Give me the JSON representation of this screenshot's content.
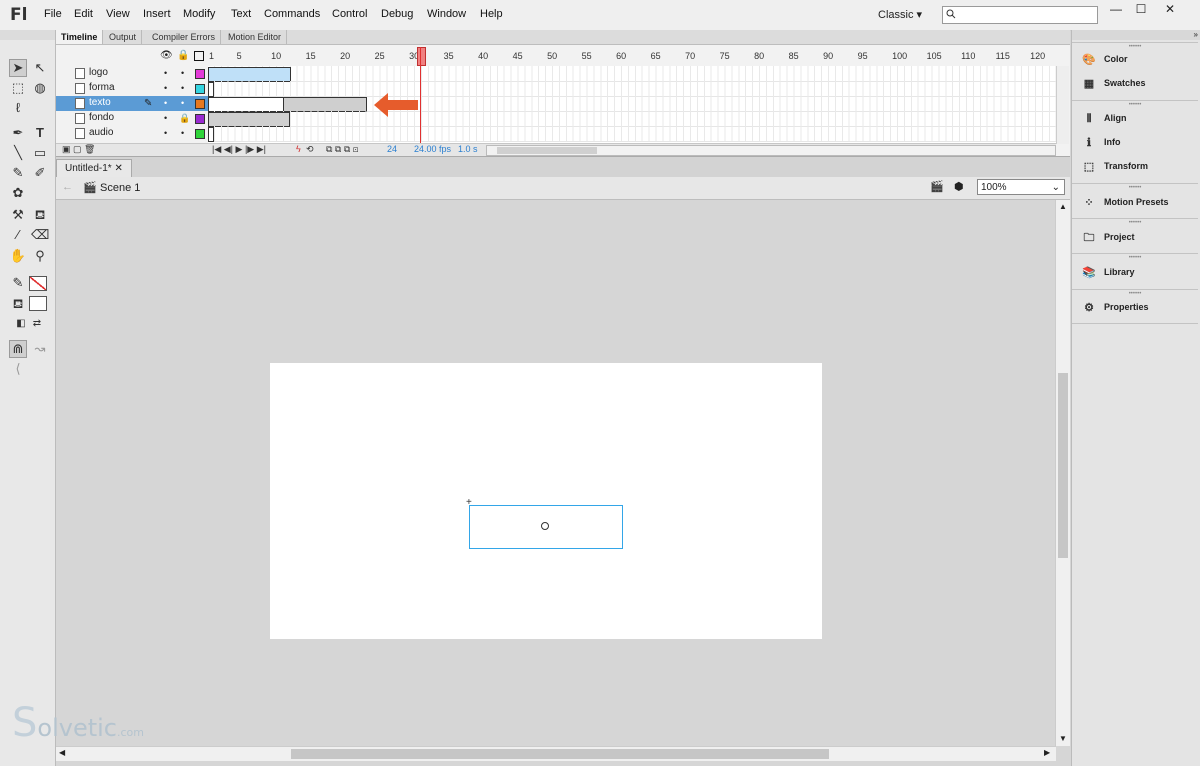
{
  "app": {
    "logo": "Fl"
  },
  "menu": [
    "File",
    "Edit",
    "View",
    "Insert",
    "Modify",
    "Text",
    "Commands",
    "Control",
    "Debug",
    "Window",
    "Help"
  ],
  "workspace": "Classic",
  "window": {
    "min": "—",
    "max": "☐",
    "close": "✕"
  },
  "timeline": {
    "tabs": [
      "Timeline",
      "Output",
      "Compiler Errors",
      "Motion Editor"
    ],
    "frame_numbers": [
      "1",
      "5",
      "10",
      "15",
      "20",
      "25",
      "30",
      "35",
      "40",
      "45",
      "50",
      "55",
      "60",
      "65",
      "70",
      "75",
      "80",
      "85",
      "90",
      "95",
      "100",
      "105",
      "110",
      "115",
      "120"
    ],
    "layers": [
      {
        "name": "logo",
        "color": "#e43bd8"
      },
      {
        "name": "forma",
        "color": "#34d4e0"
      },
      {
        "name": "texto",
        "color": "#e8781e"
      },
      {
        "name": "fondo",
        "color": "#9a2bd1"
      },
      {
        "name": "audio",
        "color": "#2fd43a"
      }
    ],
    "current_frame": "24",
    "fps": "24.00 fps",
    "time": "1.0 s"
  },
  "document": {
    "tab": "Untitled-1*",
    "scene": "Scene 1",
    "zoom": "100%"
  },
  "panels": [
    "Color",
    "Swatches",
    "Align",
    "Info",
    "Transform",
    "Motion Presets",
    "Project",
    "Library",
    "Properties"
  ],
  "watermark": {
    "main": "olvetic",
    "suffix": ".com"
  },
  "colors": {
    "selected_layer": "#5b9bd5",
    "arrow": "#e65c2c",
    "playhead": "#e03030"
  }
}
